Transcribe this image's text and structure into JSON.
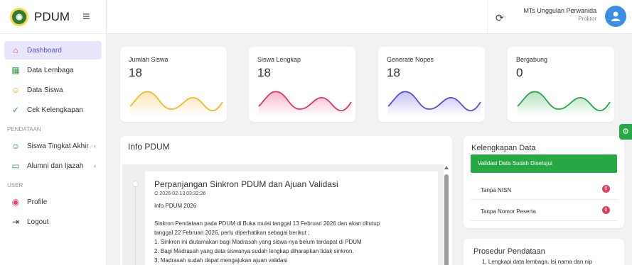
{
  "app": {
    "name": "PDUM"
  },
  "sidebar": {
    "menu": [
      {
        "label": "Dashboard"
      },
      {
        "label": "Data Lembaga"
      },
      {
        "label": "Data Siswa"
      },
      {
        "label": "Cek Kelengkapan"
      }
    ],
    "section_pendataan": "PENDATAAN",
    "pendataan": [
      {
        "label": "Siswa Tingkat Akhir"
      },
      {
        "label": "Alumni dan Ijazah"
      }
    ],
    "section_user": "USER",
    "user": [
      {
        "label": "Profile"
      },
      {
        "label": "Logout"
      }
    ]
  },
  "header": {
    "user_name": "MTs Unggulan Perwanida",
    "user_role": "Proktor"
  },
  "stats": [
    {
      "title": "Jumlah Siswa",
      "value": "18",
      "color": "#f5b82e"
    },
    {
      "title": "Siswa Lengkap",
      "value": "18",
      "color": "#e8336a"
    },
    {
      "title": "Generate Nopes",
      "value": "18",
      "color": "#5b4de0"
    },
    {
      "title": "Bergabung",
      "value": "0",
      "color": "#28a745"
    }
  ],
  "info": {
    "title": "Info PDUM",
    "post_title": "Perpanjangan Sinkron PDUM dan Ajuan Validasi",
    "post_date": "⏲ 2026-02-13 03:32:26",
    "post_sub": "Info PDUM 2026",
    "body_1": "Sinkron Pendataan pada PDUM di Buka mulai tanggal 13 Februari 2026 dan akan ditutup",
    "body_2": "tanggal 22 Februari 2026, perlu diperhatikan sebagai berikut ;",
    "body_3": "1. Sinkron ini diutamakan bagi Madrasah yang siswa nya belum terdapat di PDUM",
    "body_4": "2. Bagi Madrasah yang data siswanya sudah lengkap diharapkan tidak sinkron.",
    "body_5": "3. Madrasah sudah dapat mengajukan ajuan validasi"
  },
  "kelengkapan": {
    "title": "Kelengkapan Data",
    "alert": "Validasi Data Sudah Disetujui",
    "rows": [
      {
        "label": "Tanpa NISN",
        "count": "0"
      },
      {
        "label": "Tanpa Nomor Peserta",
        "count": "0"
      }
    ]
  },
  "prosedur": {
    "title": "Prosedur Pendataan",
    "item_1": "1. Lengkapi data lembaga. Isi nama dan nip"
  }
}
